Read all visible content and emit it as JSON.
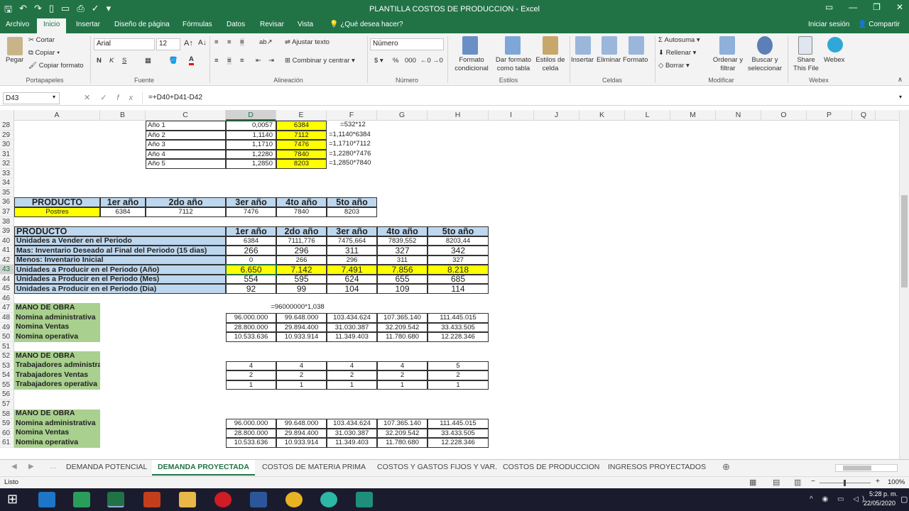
{
  "window": {
    "title": "PLANTILLA COSTOS DE PRODUCCION - Excel"
  },
  "ribbon_tabs": [
    "Archivo",
    "Inicio",
    "Insertar",
    "Diseño de página",
    "Fórmulas",
    "Datos",
    "Revisar",
    "Vista"
  ],
  "tell_me": "¿Qué desea hacer?",
  "sign_in": "Iniciar sesión",
  "share": "Compartir",
  "clipboard": {
    "paste": "Pegar",
    "cut": "Cortar",
    "copy": "Copiar",
    "format_painter": "Copiar formato",
    "group": "Portapapeles"
  },
  "font": {
    "name": "Arial",
    "size": "12",
    "group": "Fuente"
  },
  "alignment": {
    "wrap": "Ajustar texto",
    "merge": "Combinar y centrar",
    "group": "Alineación"
  },
  "number": {
    "format": "Número",
    "group": "Número"
  },
  "styles": {
    "conditional": "Formato condicional",
    "table": "Dar formato como tabla",
    "cell": "Estilos de celda",
    "group": "Estilos"
  },
  "cells": {
    "insert": "Insertar",
    "delete": "Eliminar",
    "format": "Formato",
    "group": "Celdas"
  },
  "editing": {
    "autosum": "Autosuma",
    "fill": "Rellenar",
    "clear": "Borrar",
    "sort": "Ordenar y filtrar",
    "find": "Buscar y seleccionar",
    "group": "Modificar"
  },
  "webex": {
    "share_file": "Share This File",
    "webex": "Webex",
    "group": "Webex"
  },
  "name_box": "D43",
  "formula": "=+D40+D41-D42",
  "columns": [
    "A",
    "B",
    "C",
    "D",
    "E",
    "F",
    "G",
    "H",
    "I",
    "J",
    "K",
    "L",
    "M",
    "N",
    "O",
    "P",
    "Q"
  ],
  "rows": [
    "28",
    "29",
    "30",
    "31",
    "32",
    "33",
    "34",
    "35",
    "36",
    "37",
    "38",
    "39",
    "40",
    "41",
    "42",
    "43",
    "44",
    "45",
    "46",
    "47",
    "48",
    "49",
    "50",
    "51",
    "52",
    "53",
    "54",
    "55",
    "56",
    "57",
    "58",
    "59",
    "60",
    "61"
  ],
  "factors": [
    {
      "year": "Año 1",
      "factor": "0,0057",
      "value": "6384",
      "formula": "=532*12"
    },
    {
      "year": "Año 2",
      "factor": "1,1140",
      "value": "7112",
      "formula": "=1,1140*6384"
    },
    {
      "year": "Año 3",
      "factor": "1,1710",
      "value": "7476",
      "formula": "=1,1710*7112"
    },
    {
      "year": "Año 4",
      "factor": "1,2280",
      "value": "7840",
      "formula": "=1,2280*7476"
    },
    {
      "year": "Año 5",
      "factor": "1,2850",
      "value": "8203",
      "formula": "=1,2850*7840"
    }
  ],
  "product_table": {
    "headers": [
      "PRODUCTO",
      "1er año",
      "2do año",
      "3er año",
      "4to año",
      "5to año"
    ],
    "row": [
      "Postres",
      "6384",
      "7112",
      "7476",
      "7840",
      "8203"
    ]
  },
  "production_table": {
    "headers": [
      "PRODUCTO",
      "1er año",
      "2do año",
      "3er año",
      "4to año",
      "5to año"
    ],
    "rows": [
      [
        "Unidades a Vender en el Periodo",
        "6384",
        "7111,776",
        "7475,664",
        "7839,552",
        "8203,44"
      ],
      [
        "Mas:  Inventario Deseado al Final del Periodo (15 dias)",
        "266",
        "296",
        "311",
        "327",
        "342"
      ],
      [
        "Menos: Inventario Inicial",
        "0",
        "266",
        "296",
        "311",
        "327"
      ],
      [
        "Unidades a Producir en el Periodo (Año)",
        "6.650",
        "7.142",
        "7.491",
        "7.856",
        "8.218"
      ],
      [
        "Unidades a Producir en el Periodo (Mes)",
        "554",
        "595",
        "624",
        "655",
        "685"
      ],
      [
        "Unidades a Producir en el Periodo (Dia)",
        "92",
        "99",
        "104",
        "109",
        "114"
      ]
    ]
  },
  "labor1": {
    "title": "MANO DE OBRA",
    "note": "=96000000*1,038",
    "rows": [
      [
        "Nomina administrativa",
        "96.000.000",
        "99.648.000",
        "103.434.624",
        "107.365.140",
        "111.445.015"
      ],
      [
        "Nomina Ventas",
        "28.800.000",
        "29.894.400",
        "31.030.387",
        "32.209.542",
        "33.433.505"
      ],
      [
        "Nomina operativa",
        "10.533.636",
        "10.933.914",
        "11.349.403",
        "11.780.680",
        "12.228.346"
      ]
    ]
  },
  "labor2": {
    "title": "MANO DE OBRA",
    "rows": [
      [
        "Trabajadores administrativa",
        "4",
        "4",
        "4",
        "4",
        "5"
      ],
      [
        "Trabajadores Ventas",
        "2",
        "2",
        "2",
        "2",
        "2"
      ],
      [
        "Trabajadores operativa",
        "1",
        "1",
        "1",
        "1",
        "1"
      ]
    ]
  },
  "labor3": {
    "title": "MANO DE OBRA",
    "rows": [
      [
        "Nomina administrativa",
        "96.000.000",
        "99.648.000",
        "103.434.624",
        "107.365.140",
        "111.445.015"
      ],
      [
        "Nomina Ventas",
        "28.800.000",
        "29.894.400",
        "31.030.387",
        "32.209.542",
        "33.433.505"
      ],
      [
        "Nomina operativa",
        "10.533.636",
        "10.933.914",
        "11.349.403",
        "11.780.680",
        "12.228.346"
      ]
    ]
  },
  "sheet_tabs": [
    "DEMANDA POTENCIAL",
    "DEMANDA PROYECTADA",
    "COSTOS DE MATERIA PRIMA",
    "COSTOS Y GASTOS FIJOS Y VAR.",
    "COSTOS DE PRODUCCION",
    "INGRESOS PROYECTADOS"
  ],
  "status": {
    "ready": "Listo",
    "zoom": "100%"
  },
  "clock": {
    "time": "5:28 p. m.",
    "date": "22/05/2020"
  }
}
